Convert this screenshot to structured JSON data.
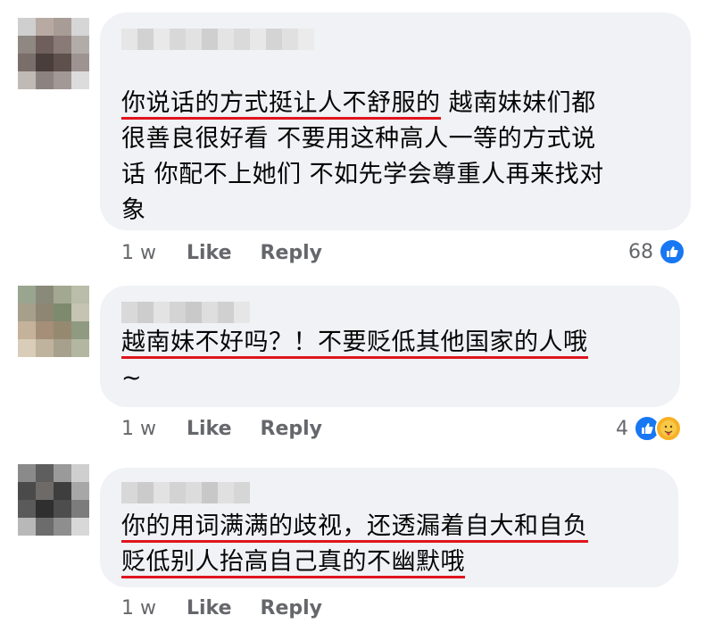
{
  "comments": [
    {
      "lines": [
        {
          "u": "你说话的方式挺让人不舒服的",
          "rest": " 越南妹妹们都"
        },
        {
          "u": "",
          "rest": "很善良很好看 不要用这种高人一等的方式说"
        },
        {
          "u": "",
          "rest": "话 你配不上她们 不如先学会尊重人再来找对"
        },
        {
          "u": "",
          "rest": "象"
        }
      ],
      "time": "1 w",
      "like_label": "Like",
      "reply_label": "Reply",
      "reaction_count": "68",
      "reactions": [
        "like-icon"
      ]
    },
    {
      "lines": [
        {
          "u": "越南妹不好吗？！不要贬低其他国家的人哦",
          "rest": ""
        },
        {
          "u": "",
          "rest": "~"
        }
      ],
      "time": "1 w",
      "like_label": "Like",
      "reply_label": "Reply",
      "reaction_count": "4",
      "reactions": [
        "like-icon",
        "care-icon"
      ]
    },
    {
      "lines": [
        {
          "u": "你的用词满满的歧视，还透漏着自大和自负",
          "rest": ""
        },
        {
          "u": "贬低别人抬高自己真的不幽默哦",
          "rest": ""
        }
      ],
      "time": "1 w",
      "like_label": "Like",
      "reply_label": "Reply",
      "reaction_count": "",
      "reactions": []
    }
  ],
  "colors": {
    "bubble": "#f0f2f5",
    "underline": "#e0151d",
    "meta_text": "#65676b",
    "like_blue": "#1877f2"
  }
}
